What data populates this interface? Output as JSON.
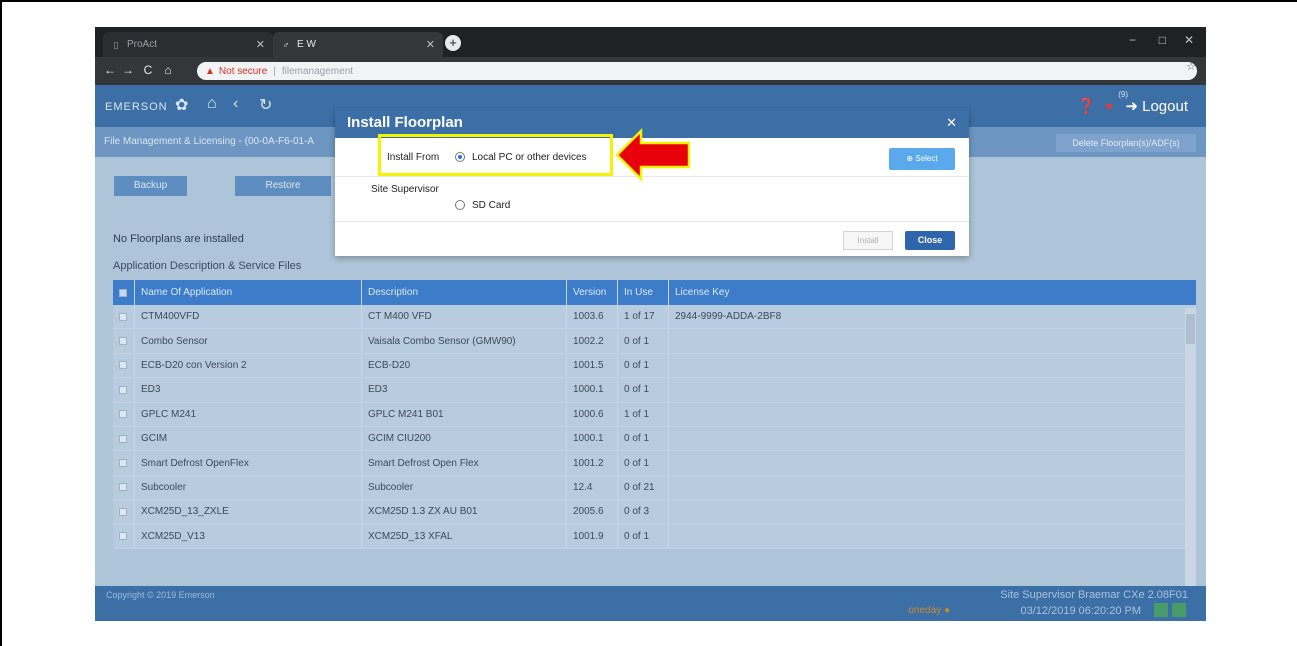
{
  "browser": {
    "tabs": [
      {
        "label": "ProAct",
        "icon": "page-icon"
      },
      {
        "label": "E W",
        "icon": "leaf-icon"
      }
    ],
    "address": {
      "security_label": "Not secure",
      "url": "filemanagement"
    },
    "window_controls": {
      "minimize": "−",
      "maximize": "□",
      "close": "✕"
    }
  },
  "app": {
    "logo": "EMERSON",
    "logout_label": "Logout",
    "alarm_count": "(9)",
    "subheader_title": "File Management & Licensing - (00-0A-F6-01-A",
    "delete_button": "Delete Floorplan(s)/ADF(s)",
    "backup_button": "Backup",
    "restore_button": "Restore",
    "no_floorplans": "No Floorplans are installed",
    "app_desc_title": "Application Description & Service Files"
  },
  "table": {
    "headers": {
      "name": "Name Of Application",
      "description": "Description",
      "version": "Version",
      "in_use": "In Use",
      "license": "License Key"
    },
    "rows": [
      {
        "name": "CTM400VFD",
        "description": "CT M400 VFD",
        "version": "1003.6",
        "in_use": "1 of 17",
        "license": "2944-9999-ADDA-2BF8"
      },
      {
        "name": "Combo Sensor",
        "description": "Vaisala Combo Sensor (GMW90)",
        "version": "1002.2",
        "in_use": "0 of 1",
        "license": ""
      },
      {
        "name": "ECB-D20 con Version 2",
        "description": "ECB-D20",
        "version": "1001.5",
        "in_use": "0 of 1",
        "license": ""
      },
      {
        "name": "ED3",
        "description": "ED3",
        "version": "1000.1",
        "in_use": "0 of 1",
        "license": ""
      },
      {
        "name": "GPLC M241",
        "description": "GPLC M241 B01",
        "version": "1000.6",
        "in_use": "1 of 1",
        "license": ""
      },
      {
        "name": "GCIM",
        "description": "GCIM CIU200",
        "version": "1000.1",
        "in_use": "0 of 1",
        "license": ""
      },
      {
        "name": "Smart Defrost OpenFlex",
        "description": "Smart Defrost Open Flex",
        "version": "1001.2",
        "in_use": "0 of 1",
        "license": ""
      },
      {
        "name": "Subcooler",
        "description": "Subcooler",
        "version": "12.4",
        "in_use": "0 of 21",
        "license": ""
      },
      {
        "name": "XCM25D_13_ZXLE",
        "description": "XCM25D 1.3 ZX AU B01",
        "version": "2005.6",
        "in_use": "0 of 3",
        "license": ""
      },
      {
        "name": "XCM25D_V13",
        "description": "XCM25D_13 XFAL",
        "version": "1001.9",
        "in_use": "0 of 1",
        "license": ""
      }
    ]
  },
  "footer": {
    "copyright": "Copyright © 2019 Emerson",
    "version": "Site Supervisor Braemar CXe 2.08F01",
    "oneday": "oneday",
    "datetime": "03/12/2019 06:20:20 PM"
  },
  "modal": {
    "title": "Install Floorplan",
    "install_from_label": "Install From",
    "option_local": "Local PC or other devices",
    "site_supervisor_label": "Site Supervisor",
    "option_sd": "SD Card",
    "select_button": "Select",
    "install_button": "Install",
    "close_button": "Close"
  },
  "colors": {
    "header_blue": "#3d6fa7",
    "highlight": "#f4f400",
    "arrow_red": "#e8000b"
  }
}
